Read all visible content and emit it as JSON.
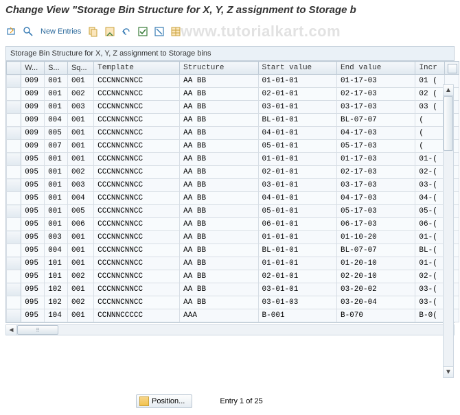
{
  "title": "Change View \"Storage Bin Structure for X, Y, Z assignment to Storage b",
  "toolbar": {
    "new_entries_label": "New Entries"
  },
  "watermark": "www.tutorialkart.com",
  "panel_title": "Storage Bin Structure for X, Y, Z assignment to Storage bins",
  "columns": {
    "w": "W...",
    "s": "S...",
    "sq": "Sq...",
    "template": "Template",
    "structure": "Structure",
    "start": "Start value",
    "end": "End value",
    "incr": "Incr"
  },
  "rows": [
    {
      "w": "009",
      "s": "001",
      "sq": "001",
      "tpl": "CCCNNCNNCC",
      "str": " AA BB",
      "start": "01-01-01",
      "end": "01-17-03",
      "incr": "01 ("
    },
    {
      "w": "009",
      "s": "001",
      "sq": "002",
      "tpl": "CCCNNCNNCC",
      "str": " AA BB",
      "start": "02-01-01",
      "end": "02-17-03",
      "incr": "02 ("
    },
    {
      "w": "009",
      "s": "001",
      "sq": "003",
      "tpl": "CCCNNCNNCC",
      "str": " AA BB",
      "start": "03-01-01",
      "end": "03-17-03",
      "incr": "03 ("
    },
    {
      "w": "009",
      "s": "004",
      "sq": "001",
      "tpl": "CCCNNCNNCC",
      "str": " AA BB",
      "start": "BL-01-01",
      "end": "BL-07-07",
      "incr": "("
    },
    {
      "w": "009",
      "s": "005",
      "sq": "001",
      "tpl": "CCCNNCNNCC",
      "str": " AA BB",
      "start": "04-01-01",
      "end": "04-17-03",
      "incr": "("
    },
    {
      "w": "009",
      "s": "007",
      "sq": "001",
      "tpl": "CCCNNCNNCC",
      "str": " AA BB",
      "start": "05-01-01",
      "end": "05-17-03",
      "incr": "("
    },
    {
      "w": "095",
      "s": "001",
      "sq": "001",
      "tpl": "CCCNNCNNCC",
      "str": " AA BB",
      "start": "01-01-01",
      "end": "01-17-03",
      "incr": "01-("
    },
    {
      "w": "095",
      "s": "001",
      "sq": "002",
      "tpl": "CCCNNCNNCC",
      "str": " AA BB",
      "start": "02-01-01",
      "end": "02-17-03",
      "incr": "02-("
    },
    {
      "w": "095",
      "s": "001",
      "sq": "003",
      "tpl": "CCCNNCNNCC",
      "str": " AA BB",
      "start": "03-01-01",
      "end": "03-17-03",
      "incr": "03-("
    },
    {
      "w": "095",
      "s": "001",
      "sq": "004",
      "tpl": "CCCNNCNNCC",
      "str": " AA BB",
      "start": "04-01-01",
      "end": "04-17-03",
      "incr": "04-("
    },
    {
      "w": "095",
      "s": "001",
      "sq": "005",
      "tpl": "CCCNNCNNCC",
      "str": " AA BB",
      "start": "05-01-01",
      "end": "05-17-03",
      "incr": "05-("
    },
    {
      "w": "095",
      "s": "001",
      "sq": "006",
      "tpl": "CCCNNCNNCC",
      "str": " AA BB",
      "start": "06-01-01",
      "end": "06-17-03",
      "incr": "06-("
    },
    {
      "w": "095",
      "s": "003",
      "sq": "001",
      "tpl": "CCCNNCNNCC",
      "str": " AA BB",
      "start": "01-01-01",
      "end": "01-10-20",
      "incr": "01-("
    },
    {
      "w": "095",
      "s": "004",
      "sq": "001",
      "tpl": "CCCNNCNNCC",
      "str": " AA BB",
      "start": "BL-01-01",
      "end": "BL-07-07",
      "incr": "BL-("
    },
    {
      "w": "095",
      "s": "101",
      "sq": "001",
      "tpl": "CCCNNCNNCC",
      "str": " AA BB",
      "start": "01-01-01",
      "end": "01-20-10",
      "incr": "01-("
    },
    {
      "w": "095",
      "s": "101",
      "sq": "002",
      "tpl": "CCCNNCNNCC",
      "str": " AA BB",
      "start": "02-01-01",
      "end": "02-20-10",
      "incr": "02-("
    },
    {
      "w": "095",
      "s": "102",
      "sq": "001",
      "tpl": "CCCNNCNNCC",
      "str": " AA BB",
      "start": "03-01-01",
      "end": "03-20-02",
      "incr": "03-("
    },
    {
      "w": "095",
      "s": "102",
      "sq": "002",
      "tpl": "CCCNNCNNCC",
      "str": " AA BB",
      "start": "03-01-03",
      "end": "03-20-04",
      "incr": "03-("
    },
    {
      "w": "095",
      "s": "104",
      "sq": "001",
      "tpl": "CCNNNCCCCC",
      "str": " AAA",
      "start": "B-001",
      "end": "B-070",
      "incr": "B-0("
    }
  ],
  "footer": {
    "position_label": "Position...",
    "entry_info": "Entry 1 of 25"
  }
}
